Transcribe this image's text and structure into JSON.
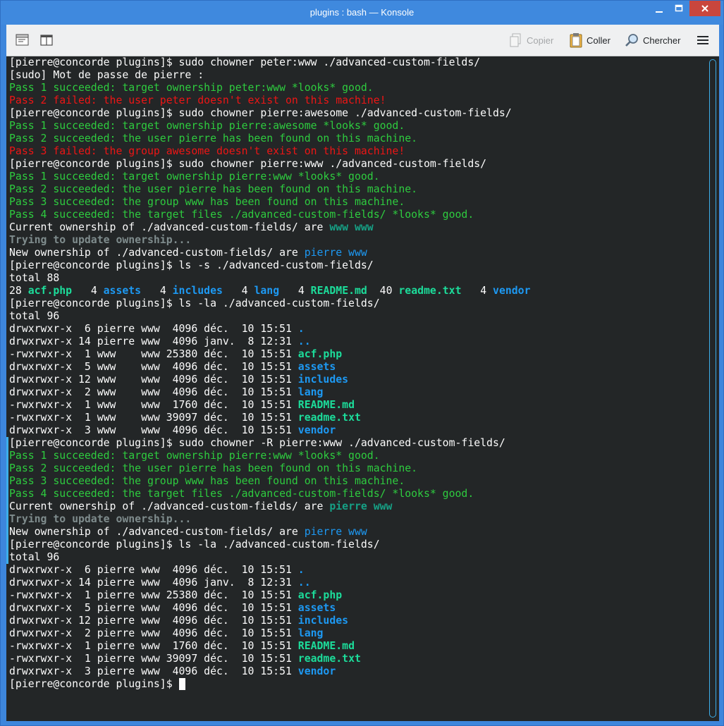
{
  "window": {
    "title": "plugins : bash — Konsole"
  },
  "toolbar": {
    "copy_label": "Copier",
    "paste_label": "Coller",
    "find_label": "Chercher",
    "icons": [
      "new-tab-icon",
      "split-view-icon",
      "copy-icon",
      "paste-icon",
      "search-icon",
      "hamburger-menu-icon"
    ]
  },
  "terminal": {
    "lines": [
      [
        {
          "t": "[pierre@concorde plugins]$ sudo chowner peter:www ./advanced-custom-fields/",
          "c": ""
        }
      ],
      [
        {
          "t": "[sudo] Mot de passe de pierre :",
          "c": ""
        }
      ],
      [
        {
          "t": "Pass 1 succeeded: target ownership peter:www *looks* good.",
          "c": "gr"
        }
      ],
      [
        {
          "t": "Pass 2 failed: the user peter doesn't exist on this machine!",
          "c": "rd"
        }
      ],
      [
        {
          "t": "[pierre@concorde plugins]$ sudo chowner pierre:awesome ./advanced-custom-fields/",
          "c": ""
        }
      ],
      [
        {
          "t": "Pass 1 succeeded: target ownership pierre:awesome *looks* good.",
          "c": "gr"
        }
      ],
      [
        {
          "t": "Pass 2 succeeded: the user pierre has been found on this machine.",
          "c": "gr"
        }
      ],
      [
        {
          "t": "Pass 3 failed: the group awesome doesn't exist on this machine!",
          "c": "rd"
        }
      ],
      [
        {
          "t": "[pierre@concorde plugins]$ sudo chowner pierre:www ./advanced-custom-fields/",
          "c": ""
        }
      ],
      [
        {
          "t": "Pass 1 succeeded: target ownership pierre:www *looks* good.",
          "c": "gr"
        }
      ],
      [
        {
          "t": "Pass 2 succeeded: the user pierre has been found on this machine.",
          "c": "gr"
        }
      ],
      [
        {
          "t": "Pass 3 succeeded: the group www has been found on this machine.",
          "c": "gr"
        }
      ],
      [
        {
          "t": "Pass 4 succeeded: the target files ./advanced-custom-fields/ *looks* good.",
          "c": "gr"
        }
      ],
      [
        {
          "t": "Current ownership of ./advanced-custom-fields/ are ",
          "c": ""
        },
        {
          "t": "www www",
          "c": "tl"
        }
      ],
      [
        {
          "t": "Trying to update ownership...",
          "c": "grey"
        }
      ],
      [
        {
          "t": "New ownership of ./advanced-custom-fields/ are ",
          "c": ""
        },
        {
          "t": "pierre www",
          "c": "bn"
        }
      ],
      [
        {
          "t": "[pierre@concorde plugins]$ ls -s ./advanced-custom-fields/",
          "c": ""
        }
      ],
      [
        {
          "t": "total 88",
          "c": ""
        }
      ],
      [
        {
          "t": "28 ",
          "c": ""
        },
        {
          "t": "acf.php",
          "c": "gb"
        },
        {
          "t": "   4 ",
          "c": ""
        },
        {
          "t": "assets",
          "c": "bl"
        },
        {
          "t": "   4 ",
          "c": ""
        },
        {
          "t": "includes",
          "c": "bl"
        },
        {
          "t": "   4 ",
          "c": ""
        },
        {
          "t": "lang",
          "c": "bl"
        },
        {
          "t": "   4 ",
          "c": ""
        },
        {
          "t": "README.md",
          "c": "gb"
        },
        {
          "t": "  40 ",
          "c": ""
        },
        {
          "t": "readme.txt",
          "c": "gb"
        },
        {
          "t": "   4 ",
          "c": ""
        },
        {
          "t": "vendor",
          "c": "bl"
        }
      ],
      [
        {
          "t": "[pierre@concorde plugins]$ ls -la ./advanced-custom-fields/",
          "c": ""
        }
      ],
      [
        {
          "t": "total 96",
          "c": ""
        }
      ],
      [
        {
          "t": "drwxrwxr-x  6 pierre www  4096 déc.  10 15:51 ",
          "c": ""
        },
        {
          "t": ".",
          "c": "bl"
        }
      ],
      [
        {
          "t": "drwxrwxr-x 14 pierre www  4096 janv.  8 12:31 ",
          "c": ""
        },
        {
          "t": "..",
          "c": "bl"
        }
      ],
      [
        {
          "t": "-rwxrwxr-x  1 www    www 25380 déc.  10 15:51 ",
          "c": ""
        },
        {
          "t": "acf.php",
          "c": "gb"
        }
      ],
      [
        {
          "t": "drwxrwxr-x  5 www    www  4096 déc.  10 15:51 ",
          "c": ""
        },
        {
          "t": "assets",
          "c": "bl"
        }
      ],
      [
        {
          "t": "drwxrwxr-x 12 www    www  4096 déc.  10 15:51 ",
          "c": ""
        },
        {
          "t": "includes",
          "c": "bl"
        }
      ],
      [
        {
          "t": "drwxrwxr-x  2 www    www  4096 déc.  10 15:51 ",
          "c": ""
        },
        {
          "t": "lang",
          "c": "bl"
        }
      ],
      [
        {
          "t": "-rwxrwxr-x  1 www    www  1760 déc.  10 15:51 ",
          "c": ""
        },
        {
          "t": "README.md",
          "c": "gb"
        }
      ],
      [
        {
          "t": "-rwxrwxr-x  1 www    www 39097 déc.  10 15:51 ",
          "c": ""
        },
        {
          "t": "readme.txt",
          "c": "gb"
        }
      ],
      [
        {
          "t": "drwxrwxr-x  3 www    www  4096 déc.  10 15:51 ",
          "c": ""
        },
        {
          "t": "vendor",
          "c": "bl"
        }
      ],
      [
        {
          "t": "[pierre@concorde plugins]$ sudo chowner -R pierre:www ./advanced-custom-fields/",
          "c": ""
        }
      ],
      [
        {
          "t": "Pass 1 succeeded: target ownership pierre:www *looks* good.",
          "c": "gr"
        }
      ],
      [
        {
          "t": "Pass 2 succeeded: the user pierre has been found on this machine.",
          "c": "gr"
        }
      ],
      [
        {
          "t": "Pass 3 succeeded: the group www has been found on this machine.",
          "c": "gr"
        }
      ],
      [
        {
          "t": "Pass 4 succeeded: the target files ./advanced-custom-fields/ *looks* good.",
          "c": "gr"
        }
      ],
      [
        {
          "t": "Current ownership of ./advanced-custom-fields/ are ",
          "c": ""
        },
        {
          "t": "pierre www",
          "c": "tl"
        }
      ],
      [
        {
          "t": "Trying to update ownership...",
          "c": "grey"
        }
      ],
      [
        {
          "t": "New ownership of ./advanced-custom-fields/ are ",
          "c": ""
        },
        {
          "t": "pierre www",
          "c": "bn"
        }
      ],
      [
        {
          "t": "[pierre@concorde plugins]$ ls -la ./advanced-custom-fields/",
          "c": ""
        }
      ],
      [
        {
          "t": "total 96",
          "c": ""
        }
      ],
      [
        {
          "t": "drwxrwxr-x  6 pierre www  4096 déc.  10 15:51 ",
          "c": ""
        },
        {
          "t": ".",
          "c": "bl"
        }
      ],
      [
        {
          "t": "drwxrwxr-x 14 pierre www  4096 janv.  8 12:31 ",
          "c": ""
        },
        {
          "t": "..",
          "c": "bl"
        }
      ],
      [
        {
          "t": "-rwxrwxr-x  1 pierre www 25380 déc.  10 15:51 ",
          "c": ""
        },
        {
          "t": "acf.php",
          "c": "gb"
        }
      ],
      [
        {
          "t": "drwxrwxr-x  5 pierre www  4096 déc.  10 15:51 ",
          "c": ""
        },
        {
          "t": "assets",
          "c": "bl"
        }
      ],
      [
        {
          "t": "drwxrwxr-x 12 pierre www  4096 déc.  10 15:51 ",
          "c": ""
        },
        {
          "t": "includes",
          "c": "bl"
        }
      ],
      [
        {
          "t": "drwxrwxr-x  2 pierre www  4096 déc.  10 15:51 ",
          "c": ""
        },
        {
          "t": "lang",
          "c": "bl"
        }
      ],
      [
        {
          "t": "-rwxrwxr-x  1 pierre www  1760 déc.  10 15:51 ",
          "c": ""
        },
        {
          "t": "README.md",
          "c": "gb"
        }
      ],
      [
        {
          "t": "-rwxrwxr-x  1 pierre www 39097 déc.  10 15:51 ",
          "c": ""
        },
        {
          "t": "readme.txt",
          "c": "gb"
        }
      ],
      [
        {
          "t": "drwxrwxr-x  3 pierre www  4096 déc.  10 15:51 ",
          "c": ""
        },
        {
          "t": "vendor",
          "c": "bl"
        }
      ],
      [
        {
          "t": "[pierre@concorde plugins]$ ",
          "c": ""
        },
        {
          "t": "",
          "c": "cursor"
        }
      ]
    ]
  }
}
